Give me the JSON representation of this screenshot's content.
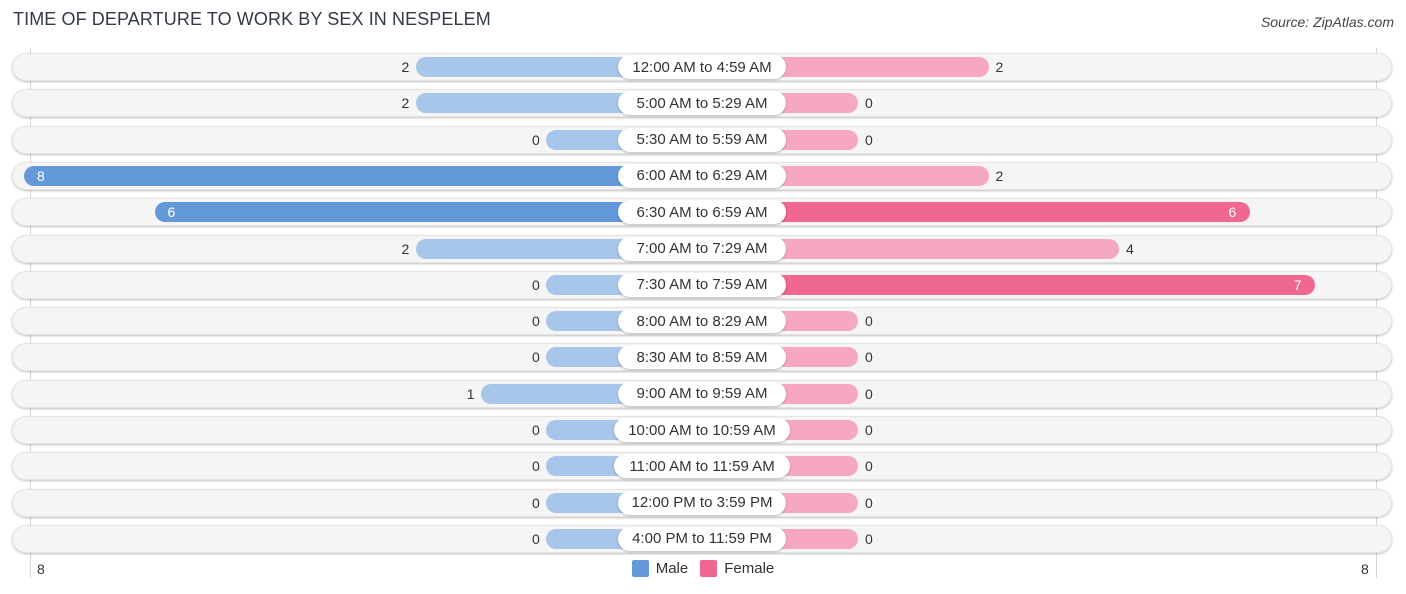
{
  "header": {
    "title": "TIME OF DEPARTURE TO WORK BY SEX IN NESPELEM",
    "source": "Source: ZipAtlas.com"
  },
  "colors": {
    "male_strong": "#6399d8",
    "male_light": "#a7c6ea",
    "female_strong": "#f06791",
    "female_light": "#f6a8c1"
  },
  "chart_data": {
    "type": "bar",
    "orientation": "horizontal-diverging",
    "title": "TIME OF DEPARTURE TO WORK BY SEX IN NESPELEM",
    "categories": [
      "12:00 AM to 4:59 AM",
      "5:00 AM to 5:29 AM",
      "5:30 AM to 5:59 AM",
      "6:00 AM to 6:29 AM",
      "6:30 AM to 6:59 AM",
      "7:00 AM to 7:29 AM",
      "7:30 AM to 7:59 AM",
      "8:00 AM to 8:29 AM",
      "8:30 AM to 8:59 AM",
      "9:00 AM to 9:59 AM",
      "10:00 AM to 10:59 AM",
      "11:00 AM to 11:59 AM",
      "12:00 PM to 3:59 PM",
      "4:00 PM to 11:59 PM"
    ],
    "series": [
      {
        "name": "Male",
        "values": [
          2,
          2,
          0,
          8,
          6,
          2,
          0,
          0,
          0,
          1,
          0,
          0,
          0,
          0
        ]
      },
      {
        "name": "Female",
        "values": [
          2,
          0,
          0,
          2,
          6,
          4,
          7,
          0,
          0,
          0,
          0,
          0,
          0,
          0
        ]
      }
    ],
    "xlim": [
      8,
      8
    ],
    "axis_ticks": {
      "left": "8",
      "right": "8"
    },
    "legend": {
      "position": "bottom-center",
      "entries": [
        "Male",
        "Female"
      ]
    },
    "grid": false
  }
}
